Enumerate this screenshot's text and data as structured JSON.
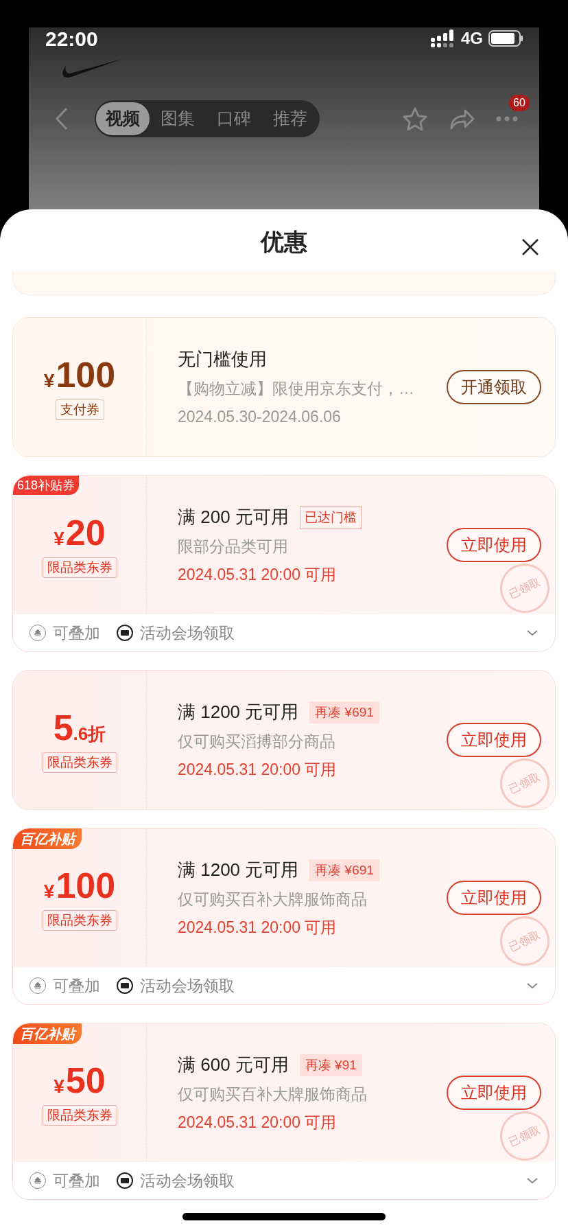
{
  "status_bar": {
    "time": "22:00",
    "network": "4G"
  },
  "nav": {
    "tabs": [
      {
        "label": "视频",
        "selected": true
      },
      {
        "label": "图集",
        "selected": false
      },
      {
        "label": "口碑",
        "selected": false
      },
      {
        "label": "推荐",
        "selected": false
      }
    ],
    "more_badge": "60"
  },
  "sheet": {
    "title": "优惠"
  },
  "coupons": [
    {
      "kind": "payment",
      "amount": {
        "kind": "money",
        "currency": "¥",
        "value": "100"
      },
      "type_badge": "支付券",
      "title": "无门槛使用",
      "description": "【购物立减】限使用京东支付，…",
      "validity": "2024.05.30-2024.06.06",
      "button": "开通领取"
    },
    {
      "kind": "category",
      "tag": {
        "kind": "plain",
        "text": "618补贴券"
      },
      "amount": {
        "kind": "money",
        "currency": "¥",
        "value": "20"
      },
      "type_badge": "限品类东券",
      "title": "满 200 元可用",
      "threshold": {
        "kind": "outline",
        "text": "已达门槛"
      },
      "description": "限部分品类可用",
      "validity": "2024.05.31 20:00 可用",
      "button": "立即使用",
      "stamp": "已领取",
      "footer": {
        "stack": "可叠加",
        "source": "活动会场领取"
      }
    },
    {
      "kind": "category",
      "amount": {
        "kind": "discount",
        "value": "5",
        "suffix": ".6折"
      },
      "type_badge": "限品类东券",
      "title": "满 1200 元可用",
      "threshold": {
        "kind": "filled",
        "text": "再凑 ¥691"
      },
      "description": "仅可购买滔搏部分商品",
      "validity": "2024.05.31 20:00 可用",
      "button": "立即使用",
      "stamp": "已领取"
    },
    {
      "kind": "category",
      "tag": {
        "kind": "brand",
        "text": "百亿补贴"
      },
      "amount": {
        "kind": "money",
        "currency": "¥",
        "value": "100"
      },
      "type_badge": "限品类东券",
      "title": "满 1200 元可用",
      "threshold": {
        "kind": "filled",
        "text": "再凑 ¥691"
      },
      "description": "仅可购买百补大牌服饰商品",
      "validity": "2024.05.31 20:00 可用",
      "button": "立即使用",
      "stamp": "已领取",
      "footer": {
        "stack": "可叠加",
        "source": "活动会场领取"
      }
    },
    {
      "kind": "category",
      "tag": {
        "kind": "brand",
        "text": "百亿补贴"
      },
      "amount": {
        "kind": "money",
        "currency": "¥",
        "value": "50"
      },
      "type_badge": "限品类东券",
      "title": "满 600 元可用",
      "threshold": {
        "kind": "filled",
        "text": "再凑 ¥91"
      },
      "description": "仅可购买百补大牌服饰商品",
      "validity": "2024.05.31 20:00 可用",
      "button": "立即使用",
      "stamp": "已领取",
      "footer": {
        "stack": "可叠加",
        "source": "活动会场领取"
      }
    }
  ]
}
